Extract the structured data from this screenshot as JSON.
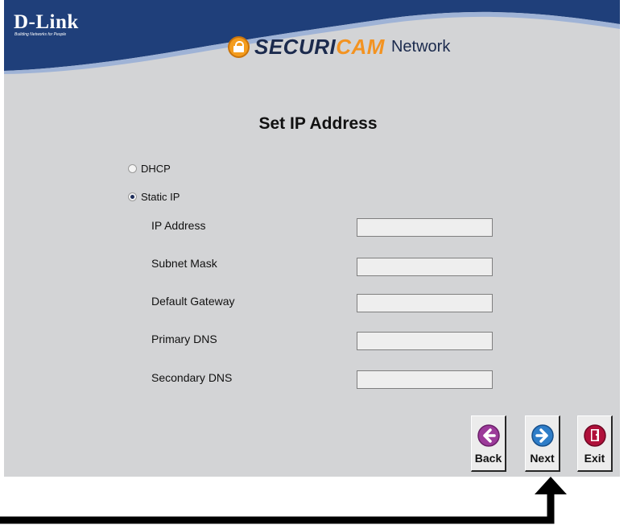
{
  "header": {
    "brand_name": "D-Link",
    "brand_tagline": "Building Networks for People",
    "product_part1": "SECURI",
    "product_part2": "CAM",
    "product_part3": "Network"
  },
  "page": {
    "title": "Set IP Address"
  },
  "mode": {
    "dhcp_label": "DHCP",
    "static_label": "Static IP",
    "selected": "Static IP"
  },
  "fields": [
    {
      "label": "IP Address",
      "value": ""
    },
    {
      "label": "Subnet Mask",
      "value": ""
    },
    {
      "label": "Default Gateway",
      "value": ""
    },
    {
      "label": "Primary DNS",
      "value": ""
    },
    {
      "label": "Secondary DNS",
      "value": ""
    }
  ],
  "buttons": {
    "back": "Back",
    "next": "Next",
    "exit": "Exit"
  },
  "colors": {
    "header_blue": "#1f3f7a",
    "panel_gray": "#d3d4d6",
    "back_icon": "#9c3a9a",
    "next_icon": "#2e7dc8",
    "exit_icon": "#b0103a",
    "accent_orange": "#f39321"
  },
  "icons": {
    "back": "left-arrow-circle-icon",
    "next": "right-arrow-circle-icon",
    "exit": "exit-door-icon"
  }
}
